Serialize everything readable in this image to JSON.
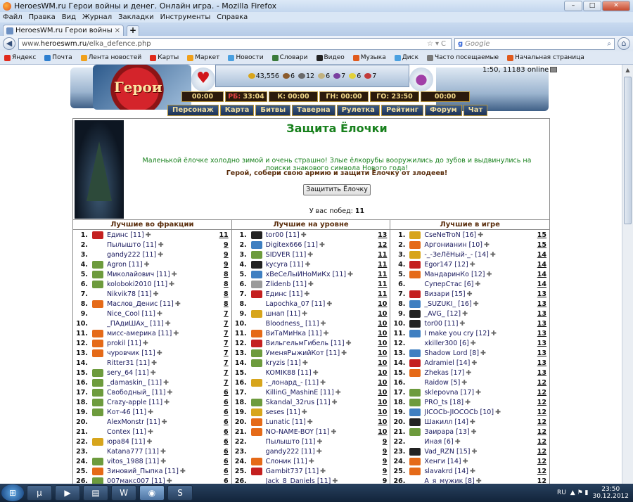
{
  "window": {
    "title": "HeroesWM.ru Герои войны и денег. Онлайн игра. - Mozilla Firefox"
  },
  "menu": [
    "Файл",
    "Правка",
    "Вид",
    "Журнал",
    "Закладки",
    "Инструменты",
    "Справка"
  ],
  "tab": {
    "label": "HeroesWM.ru Герои войны и денег. Он...",
    "close": "×",
    "new": "+"
  },
  "nav": {
    "url_prefix": "www.",
    "url_host": "heroeswm.ru",
    "url_path": "/elka_defence.php",
    "search_placeholder": "Google",
    "search_engine": "g"
  },
  "bookmarks": [
    "Яндекс",
    "Почта",
    "Лента новостей",
    "Карты",
    "Маркет",
    "Новости",
    "Словари",
    "Видео",
    "Музыка",
    "Диск",
    "Часто посещаемые",
    "Начальная страница"
  ],
  "game": {
    "online": "1:50, 11183 online",
    "resources": [
      "43,556",
      "6",
      "12",
      "6",
      "7",
      "6",
      "7"
    ],
    "timers": [
      {
        "label": "00:00"
      },
      {
        "label": "33:04",
        "prefix": "РБ:"
      },
      {
        "label": "К: 00:00"
      },
      {
        "label": "ГН: 00:00"
      },
      {
        "label": "ГО: 23:50"
      },
      {
        "label": "00:00"
      }
    ],
    "menu": [
      "Персонаж",
      "Карта",
      "Битвы",
      "Таверна",
      "Рулетка",
      "Рейтинг",
      "Форум",
      "Чат"
    ]
  },
  "promo": {
    "title": "Защита Ёлочки",
    "description": "Маленькой ёлочке холодно зимой и очень страшно! Злые ёлкорубы вооружились до зубов и выдвинулись на поиски знакового символа Нового года!",
    "call": "Герой, собери свою армию и защити Ёлочку от злодеев!",
    "button": "Защитить Ёлочку",
    "wins_label": "У вас побед:",
    "wins_value": "11"
  },
  "columns": [
    {
      "title": "Лучшие во фракции",
      "rows": [
        {
          "n": "1.",
          "icon": "guild",
          "name": "Единс [11]",
          "score": "11"
        },
        {
          "n": "2.",
          "icon": "blank",
          "name": "Пылышто [11]",
          "score": "9"
        },
        {
          "n": "3.",
          "icon": "blank",
          "name": "gandy222 [11]",
          "score": "9"
        },
        {
          "n": "4.",
          "icon": "orc",
          "name": "Agron [11]",
          "score": "9"
        },
        {
          "n": "5.",
          "icon": "orc",
          "name": "Миколайович [11]",
          "score": "8"
        },
        {
          "n": "6.",
          "icon": "orc",
          "name": "koloboki2010 [11]",
          "score": "8"
        },
        {
          "n": "7.",
          "icon": "blank",
          "name": "Nikvik78 [11]",
          "score": "8"
        },
        {
          "n": "8.",
          "icon": "fire",
          "name": "Маслов_Денис [11]",
          "score": "8"
        },
        {
          "n": "9.",
          "icon": "blank",
          "name": "Nice_Cool [11]",
          "score": "7"
        },
        {
          "n": "10.",
          "icon": "blank",
          "name": "_ПАдиШАх_ [11]",
          "score": "7"
        },
        {
          "n": "11.",
          "icon": "fire",
          "name": "мисс-америка [11]",
          "score": "7"
        },
        {
          "n": "12.",
          "icon": "fire",
          "name": "prokil [11]",
          "score": "7"
        },
        {
          "n": "13.",
          "icon": "fire",
          "name": "чуровчик [11]",
          "score": "7"
        },
        {
          "n": "14.",
          "icon": "blank",
          "name": "Ritter31 [11]",
          "score": "7"
        },
        {
          "n": "15.",
          "icon": "orc",
          "name": "sery_64 [11]",
          "score": "7"
        },
        {
          "n": "16.",
          "icon": "orc",
          "name": "_damaskin_ [11]",
          "score": "7"
        },
        {
          "n": "17.",
          "icon": "orc",
          "name": "Свободный_ [11]",
          "score": "6"
        },
        {
          "n": "18.",
          "icon": "orc",
          "name": "Crazy-apple [11]",
          "score": "6"
        },
        {
          "n": "19.",
          "icon": "orc",
          "name": "Кот-46 [11]",
          "score": "6"
        },
        {
          "n": "20.",
          "icon": "blank",
          "name": "AlexMonstr [11]",
          "score": "6"
        },
        {
          "n": "21.",
          "icon": "blank",
          "name": "Contex [11]",
          "score": "6"
        },
        {
          "n": "22.",
          "icon": "gold",
          "name": "юра84 [11]",
          "score": "6"
        },
        {
          "n": "23.",
          "icon": "blank",
          "name": "Katana777 [11]",
          "score": "6"
        },
        {
          "n": "24.",
          "icon": "orc",
          "name": "vitos_1988 [11]",
          "score": "6"
        },
        {
          "n": "25.",
          "icon": "fire",
          "name": "Зиновий_Пыпка [11]",
          "score": "6"
        },
        {
          "n": "26.",
          "icon": "orc",
          "name": "007макс007 [11]",
          "score": "6"
        }
      ]
    },
    {
      "title": "Лучшие на уровне",
      "rows": [
        {
          "n": "1.",
          "icon": "dark",
          "name": "tor00 [11]",
          "score": "13"
        },
        {
          "n": "2.",
          "icon": "globe",
          "name": "Digitex666 [11]",
          "score": "12"
        },
        {
          "n": "3.",
          "icon": "orc",
          "name": "SIDVER [11]",
          "score": "11"
        },
        {
          "n": "4.",
          "icon": "dark",
          "name": "kycyra [11]",
          "score": "11"
        },
        {
          "n": "5.",
          "icon": "globe",
          "name": "хВеСеЛыЙНоМиКх [11]",
          "score": "11"
        },
        {
          "n": "6.",
          "icon": "skull",
          "name": "Zlidenb [11]",
          "score": "11"
        },
        {
          "n": "7.",
          "icon": "guild",
          "name": "Единс [11]",
          "score": "11"
        },
        {
          "n": "8.",
          "icon": "blank",
          "name": "Lapochka_07 [11]",
          "score": "10"
        },
        {
          "n": "9.",
          "icon": "gold",
          "name": "шнап [11]",
          "score": "10"
        },
        {
          "n": "10.",
          "icon": "blank",
          "name": "Bloodness_ [11]",
          "score": "10"
        },
        {
          "n": "11.",
          "icon": "fire",
          "name": "ВиТаМиНка [11]",
          "score": "10"
        },
        {
          "n": "12.",
          "icon": "guild",
          "name": "ВильгельмГибель [11]",
          "score": "10"
        },
        {
          "n": "13.",
          "icon": "orc",
          "name": "УменяРыжийКот [11]",
          "score": "10"
        },
        {
          "n": "14.",
          "icon": "orc",
          "name": "kryzis [11]",
          "score": "10"
        },
        {
          "n": "15.",
          "icon": "blank",
          "name": "KOMIK88 [11]",
          "score": "10"
        },
        {
          "n": "16.",
          "icon": "gold",
          "name": "-_лонард_- [11]",
          "score": "10"
        },
        {
          "n": "17.",
          "icon": "blank",
          "name": "KillinG_MashinE [11]",
          "score": "10"
        },
        {
          "n": "18.",
          "icon": "orc",
          "name": "Skandal_32rus [11]",
          "score": "10"
        },
        {
          "n": "19.",
          "icon": "gold",
          "name": "seses [11]",
          "score": "10"
        },
        {
          "n": "20.",
          "icon": "fire",
          "name": "Lunatic [11]",
          "score": "10"
        },
        {
          "n": "21.",
          "icon": "fire",
          "name": "NO-NAME-BOY [11]",
          "score": "10"
        },
        {
          "n": "22.",
          "icon": "blank",
          "name": "Пылышто [11]",
          "score": "9"
        },
        {
          "n": "23.",
          "icon": "blank",
          "name": "gandy222 [11]",
          "score": "9"
        },
        {
          "n": "24.",
          "icon": "fire",
          "name": "Слоник [11]",
          "score": "9"
        },
        {
          "n": "25.",
          "icon": "guild",
          "name": "Gambit737 [11]",
          "score": "9"
        },
        {
          "n": "26.",
          "icon": "blank",
          "name": "Jack_8_Daniels [11]",
          "score": "9"
        }
      ]
    },
    {
      "title": "Лучшие в игре",
      "rows": [
        {
          "n": "1.",
          "icon": "gold",
          "name": "CseNeTroN [16]",
          "score": "15"
        },
        {
          "n": "2.",
          "icon": "fire",
          "name": "Аргонианин [10]",
          "score": "15"
        },
        {
          "n": "3.",
          "icon": "gold",
          "name": "-_-ЗеЛёНый-_- [14]",
          "score": "14"
        },
        {
          "n": "4.",
          "icon": "guild",
          "name": "Egor147 [12]",
          "score": "14"
        },
        {
          "n": "5.",
          "icon": "fire",
          "name": "МандаринКо [12]",
          "score": "14"
        },
        {
          "n": "6.",
          "icon": "blank",
          "name": "СуперСтас [6]",
          "score": "14"
        },
        {
          "n": "7.",
          "icon": "guild",
          "name": "Визари [15]",
          "score": "13"
        },
        {
          "n": "8.",
          "icon": "globe",
          "name": "_SUZUKI_ [16]",
          "score": "13"
        },
        {
          "n": "9.",
          "icon": "dark",
          "name": "_AVG_ [12]",
          "score": "13"
        },
        {
          "n": "10.",
          "icon": "dark",
          "name": "tor00 [11]",
          "score": "13"
        },
        {
          "n": "11.",
          "icon": "globe",
          "name": "I make you cry [12]",
          "score": "13"
        },
        {
          "n": "12.",
          "icon": "blank",
          "name": "xkiller300 [6]",
          "score": "13"
        },
        {
          "n": "13.",
          "icon": "globe",
          "name": "Shadow Lord [8]",
          "score": "13"
        },
        {
          "n": "14.",
          "icon": "guild",
          "name": "Adramiel [14]",
          "score": "13"
        },
        {
          "n": "15.",
          "icon": "fire",
          "name": "Zhekas [17]",
          "score": "13"
        },
        {
          "n": "16.",
          "icon": "blank",
          "name": "Raidow [5]",
          "score": "12"
        },
        {
          "n": "17.",
          "icon": "orc",
          "name": "sklepovna [17]",
          "score": "12"
        },
        {
          "n": "18.",
          "icon": "orc",
          "name": "PRO_ts [18]",
          "score": "12"
        },
        {
          "n": "19.",
          "icon": "globe",
          "name": "JICOCb-JIOCOCb [10]",
          "score": "12"
        },
        {
          "n": "20.",
          "icon": "dark",
          "name": "Шакилл [14]",
          "score": "12"
        },
        {
          "n": "21.",
          "icon": "orc",
          "name": "Заирара [13]",
          "score": "12"
        },
        {
          "n": "22.",
          "icon": "blank",
          "name": "Иная [6]",
          "score": "12"
        },
        {
          "n": "23.",
          "icon": "dark",
          "name": "Vad_RZN [15]",
          "score": "12"
        },
        {
          "n": "24.",
          "icon": "fire",
          "name": "Хенги [14]",
          "score": "12"
        },
        {
          "n": "25.",
          "icon": "fire",
          "name": "slavakrd [14]",
          "score": "12"
        },
        {
          "n": "26.",
          "icon": "blank",
          "name": "А_я_мужик [8]",
          "score": "12"
        }
      ]
    }
  ],
  "taskbar": {
    "lang": "RU",
    "time": "23:50",
    "date": "30.12.2012"
  }
}
